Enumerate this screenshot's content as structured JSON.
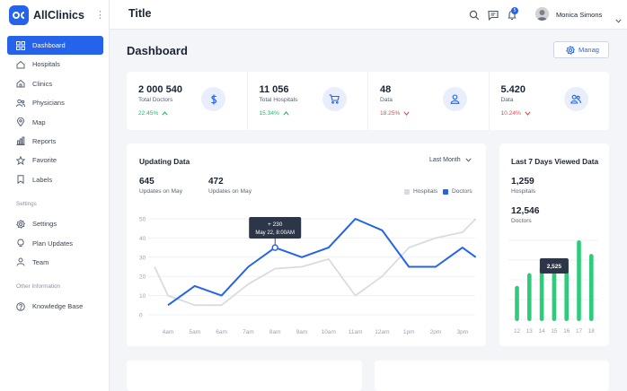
{
  "app": {
    "brand": "AllClinics",
    "title": "Title"
  },
  "user": {
    "name": "Monica Simons",
    "notifications": "5"
  },
  "sidebar": {
    "items": [
      {
        "label": "Dashboard",
        "icon": "grid-icon",
        "active": true
      },
      {
        "label": "Hospitals",
        "icon": "home-icon"
      },
      {
        "label": "Clinics",
        "icon": "home-icon"
      },
      {
        "label": "Physicians",
        "icon": "users-icon"
      },
      {
        "label": "Map",
        "icon": "map-pin-icon"
      },
      {
        "label": "Reports",
        "icon": "bar-chart-icon"
      },
      {
        "label": "Favorite",
        "icon": "star-icon"
      },
      {
        "label": "Labels",
        "icon": "bookmark-icon"
      }
    ],
    "settings_title": "Settings",
    "settings_items": [
      {
        "label": "Settings",
        "icon": "gear-icon"
      },
      {
        "label": "Plan Updates",
        "icon": "bulb-icon"
      },
      {
        "label": "Team",
        "icon": "user-icon"
      }
    ],
    "other_title": "Other Information",
    "other_items": [
      {
        "label": "Knowledge Base",
        "icon": "help-icon"
      }
    ]
  },
  "main": {
    "title": "Dashboard",
    "manage_label": "Manag",
    "stats": [
      {
        "value": "2 000 540",
        "label": "Total Doctors",
        "change": "22.45%",
        "direction": "up",
        "icon": "dollar-icon"
      },
      {
        "value": "11 056",
        "label": "Total Hospitals",
        "change": "15.34%",
        "direction": "up",
        "icon": "cart-icon"
      },
      {
        "value": "48",
        "label": "Data",
        "change": "18.25%",
        "direction": "down",
        "icon": "user-icon"
      },
      {
        "value": "5.420",
        "label": "Data",
        "change": "10.24%",
        "direction": "down",
        "icon": "users-icon"
      }
    ],
    "updating": {
      "title": "Updating Data",
      "period": "Last Month",
      "metric1_value": "645",
      "metric1_label": "Updates on May",
      "metric2_value": "472",
      "metric2_label": "Updates on May",
      "legend_hospitals": "Hospitals",
      "legend_doctors": "Doctors",
      "tooltip_value": "+ 230",
      "tooltip_date": "May 22, 8:00AM"
    },
    "viewed": {
      "title": "Last 7 Days Viewed Data",
      "hospitals_value": "1,259",
      "hospitals_label": "Hospitals",
      "doctors_value": "12,546",
      "doctors_label": "Doctors",
      "tooltip": "2,525"
    }
  },
  "colors": {
    "accent": "#2563eb",
    "positive": "#1fb872",
    "negative": "#e5484d",
    "hospitals_line": "#d9dbe0",
    "bars": "#2ecc7a"
  },
  "chart_data": [
    {
      "type": "line",
      "title": "Updating Data",
      "x": [
        "4am",
        "5am",
        "6am",
        "7am",
        "8am",
        "9am",
        "10am",
        "11am",
        "12am",
        "1pm",
        "2pm",
        "3pm"
      ],
      "y_ticks": [
        0,
        10,
        20,
        30,
        40,
        50
      ],
      "ylim": [
        0,
        50
      ],
      "grid": true,
      "legend": "top-right",
      "series": [
        {
          "name": "Hospitals",
          "color": "#d9dbe0",
          "points": [
            [
              -0.5,
              25
            ],
            [
              0,
              10
            ],
            [
              1,
              5
            ],
            [
              2,
              5
            ],
            [
              3,
              16
            ],
            [
              4,
              24
            ],
            [
              5,
              25
            ],
            [
              6,
              29
            ],
            [
              7,
              10
            ],
            [
              8,
              20
            ],
            [
              9,
              35
            ],
            [
              10,
              40
            ],
            [
              11,
              43
            ],
            [
              11.5,
              50
            ]
          ]
        },
        {
          "name": "Doctors",
          "color": "#2563eb",
          "points": [
            [
              0,
              5
            ],
            [
              1,
              15
            ],
            [
              2,
              10
            ],
            [
              3,
              25
            ],
            [
              4,
              35
            ],
            [
              5,
              30
            ],
            [
              6,
              35
            ],
            [
              7,
              50
            ],
            [
              8,
              44
            ],
            [
              9,
              25
            ],
            [
              10,
              25
            ],
            [
              11,
              35
            ],
            [
              11.5,
              30
            ]
          ]
        }
      ],
      "highlight_index": 4
    },
    {
      "type": "bar",
      "title": "Last 7 Days Viewed Data",
      "categories": [
        "12",
        "13",
        "14",
        "15",
        "16",
        "17",
        "18"
      ],
      "values": [
        1100,
        1500,
        1700,
        1600,
        1850,
        2525,
        2100
      ],
      "highlight_index": 3
    }
  ]
}
